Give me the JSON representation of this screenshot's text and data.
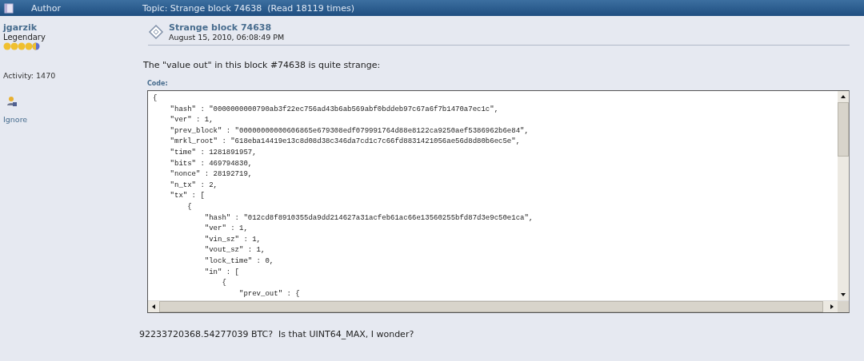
{
  "header": {
    "author_label": "Author",
    "topic": "Topic: Strange block 74638  (Read 18119 times)"
  },
  "author": {
    "name": "jgarzik",
    "rank": "Legendary",
    "stars": 4.5,
    "activity": "Activity: 1470",
    "ignore": "Ignore"
  },
  "post": {
    "title": "Strange block 74638",
    "date": "August 15, 2010, 06:08:49 PM",
    "intro": "The \"value out\" in this block #74638 is quite strange:",
    "code_label": "Code:",
    "code_lines": [
      "{",
      "    \"hash\" : \"0000000000790ab3f22ec756ad43b6ab569abf0bddeb97c67a6f7b1470a7ec1c\",",
      "    \"ver\" : 1,",
      "    \"prev_block\" : \"00000000000606865e679308edf079991764d88e8122ca9250aef5386962b6e84\",",
      "    \"mrkl_root\" : \"618eba14419e13c8d08d38c346da7cd1c7c66fd8831421056ae56d8d80b6ec5e\",",
      "    \"time\" : 1281891957,",
      "    \"bits\" : 469794830,",
      "    \"nonce\" : 28192719,",
      "    \"n_tx\" : 2,",
      "    \"tx\" : [",
      "        {",
      "            \"hash\" : \"012cd8f8910355da9dd214627a31acfeb61ac66e13560255bfd87d3e9c50e1ca\",",
      "            \"ver\" : 1,",
      "            \"vin_sz\" : 1,",
      "            \"vout_sz\" : 1,",
      "            \"lock_time\" : 0,",
      "            \"in\" : [",
      "                {",
      "                    \"prev_out\" : {"
    ],
    "closing": "92233720368.54277039 BTC?  Is that UINT64_MAX, I wonder?"
  }
}
